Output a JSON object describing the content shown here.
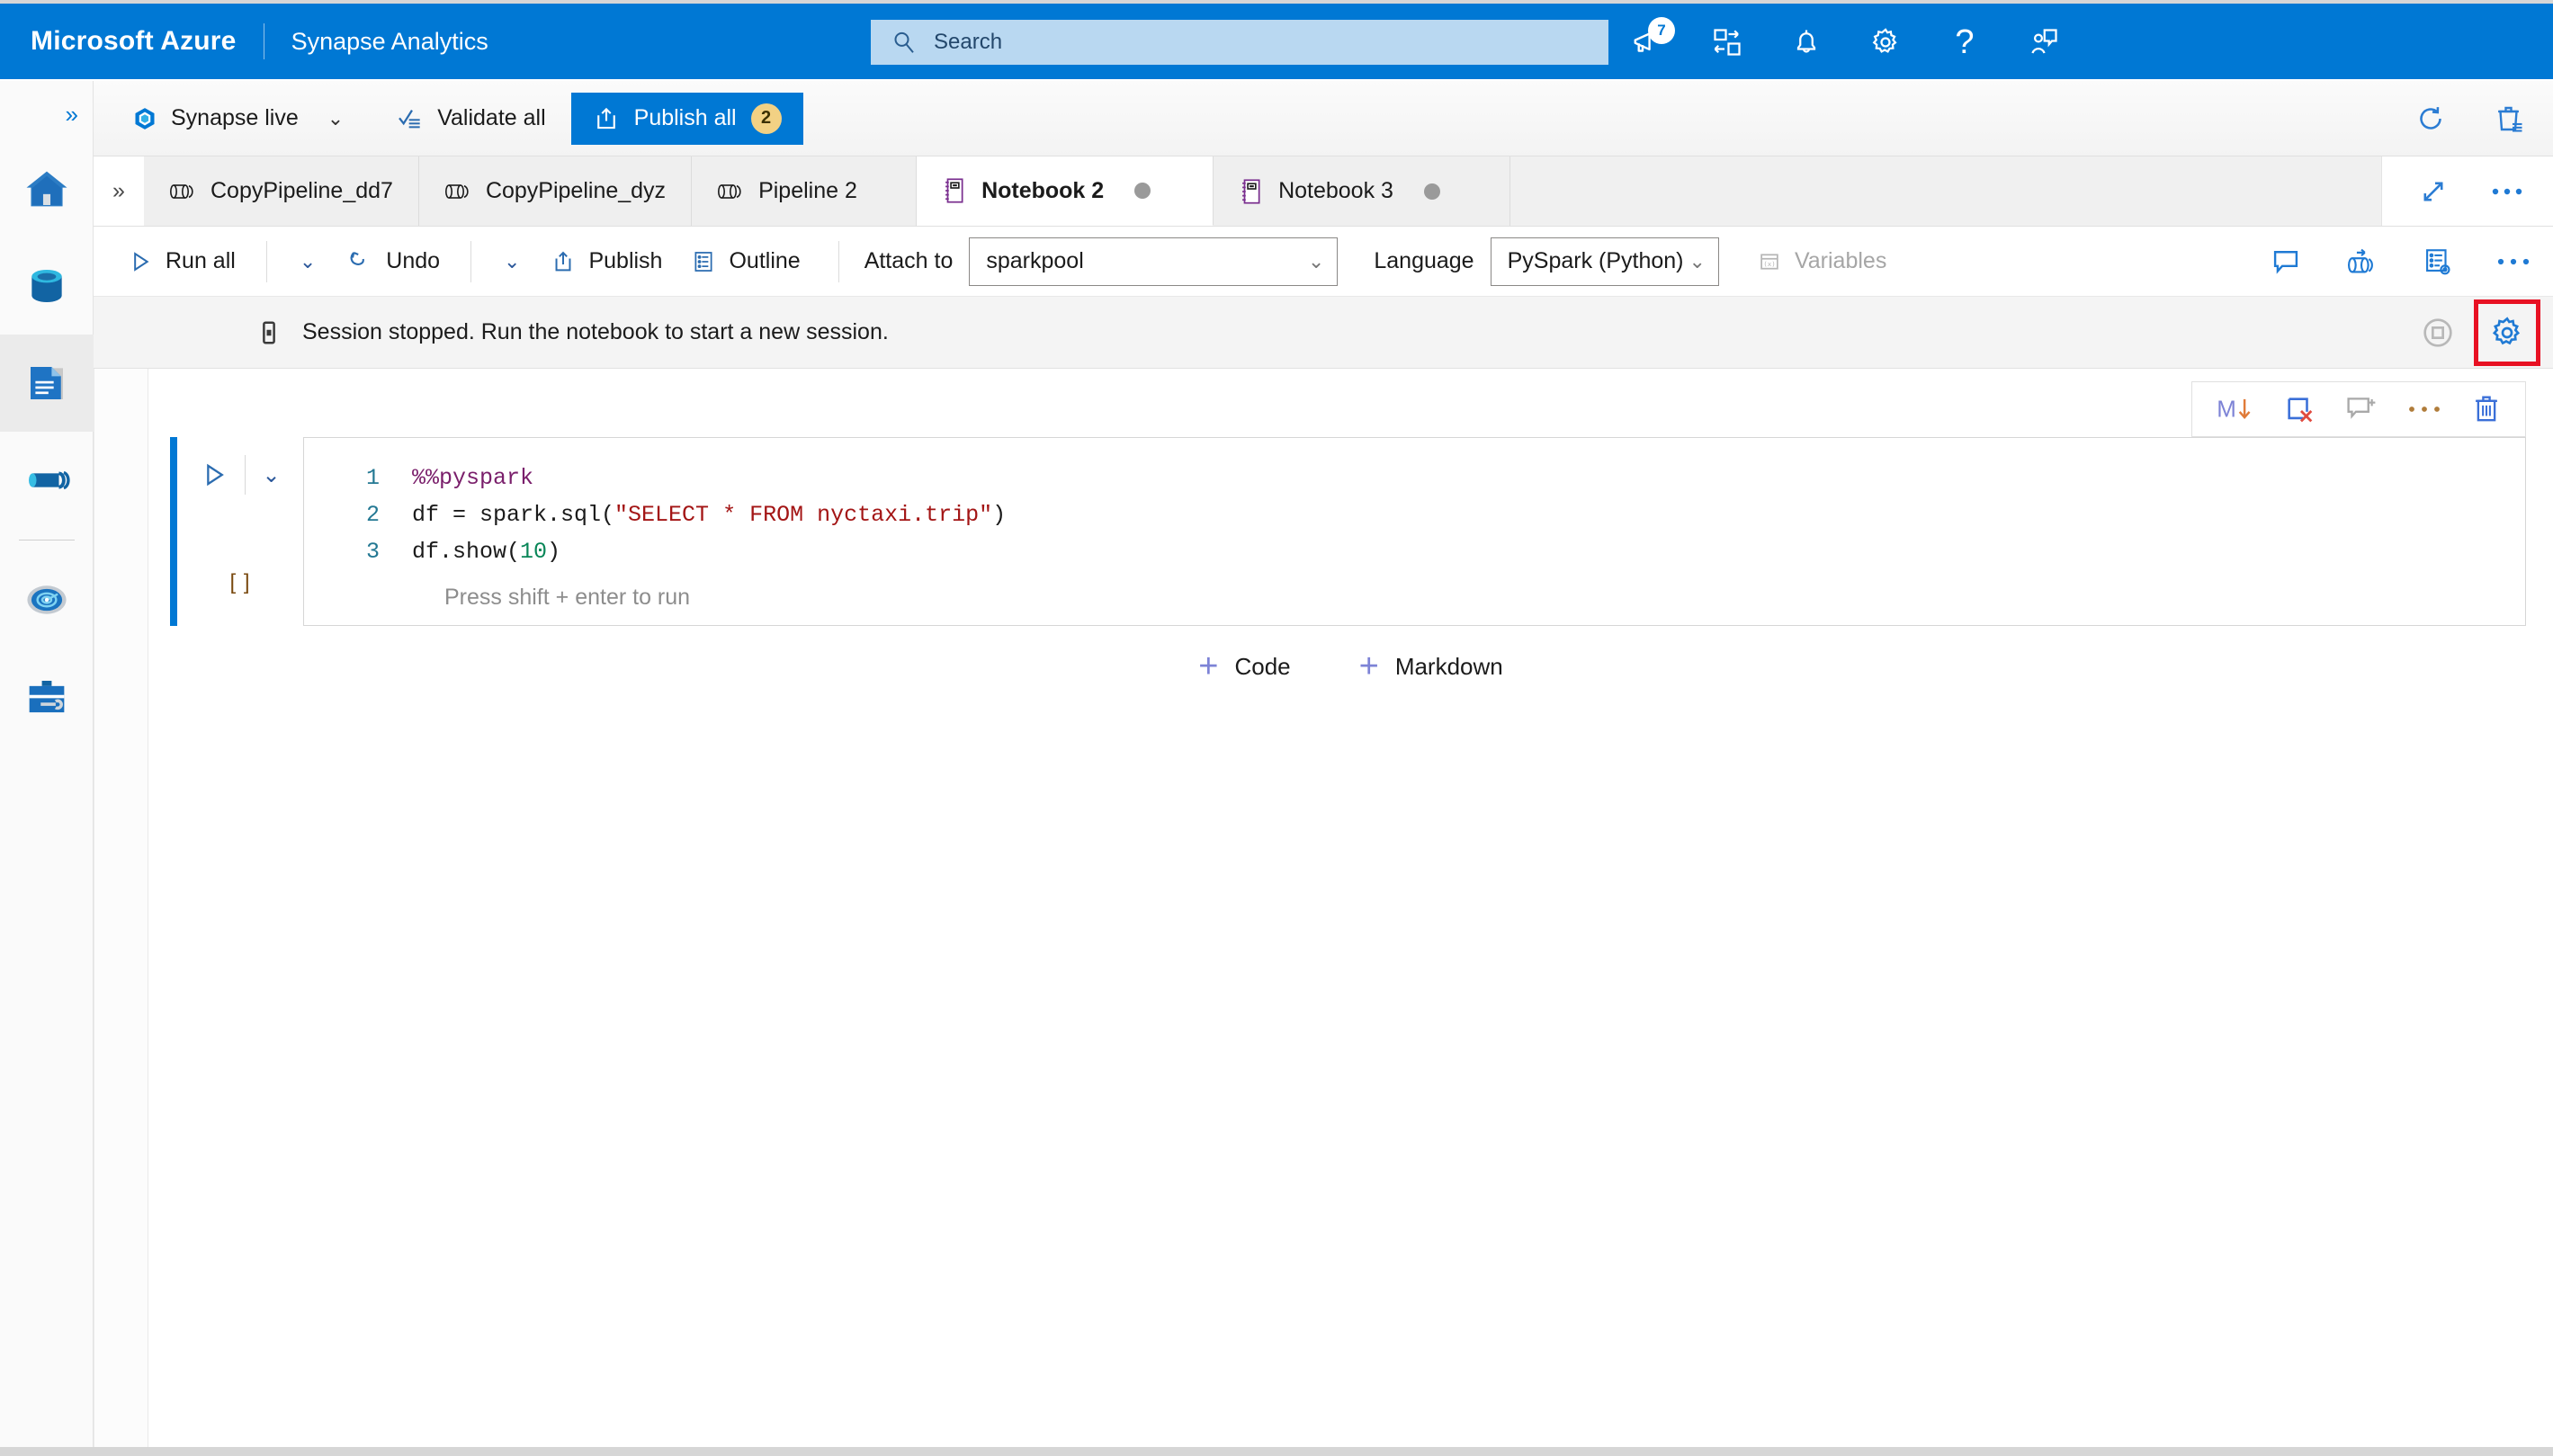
{
  "topbar": {
    "brand": "Microsoft Azure",
    "service": "Synapse Analytics",
    "search_placeholder": "Search",
    "icons": [
      {
        "name": "announcements-icon",
        "badge": "7"
      },
      {
        "name": "cloud-shell-icon",
        "badge": ""
      },
      {
        "name": "notifications-bell-icon",
        "badge": ""
      },
      {
        "name": "settings-gear-icon",
        "badge": ""
      },
      {
        "name": "help-question-icon",
        "badge": ""
      },
      {
        "name": "feedback-icon",
        "badge": ""
      }
    ],
    "accent_color": "#0078d4"
  },
  "rail": {
    "expand_label": "»",
    "items": [
      {
        "name": "home",
        "icon": "home-icon",
        "selected": false
      },
      {
        "name": "data",
        "icon": "data-cylinder-icon",
        "selected": false
      },
      {
        "name": "develop",
        "icon": "develop-document-icon",
        "selected": true
      },
      {
        "name": "integrate",
        "icon": "integrate-pipeline-icon",
        "selected": false
      },
      {
        "name": "monitor",
        "icon": "monitor-radar-icon",
        "selected": false
      },
      {
        "name": "manage",
        "icon": "manage-toolbox-icon",
        "selected": false
      }
    ]
  },
  "workspace_toolbar": {
    "mode_label": "Synapse live",
    "validate_label": "Validate all",
    "publish_all_label": "Publish all",
    "publish_all_count": "2",
    "publish_color": "#0078d4",
    "badge_color": "#f2d184",
    "refresh_icon": "refresh-icon",
    "discard_icon": "discard-all-trash-icon"
  },
  "tabs": {
    "overflow_label": "»",
    "items": [
      {
        "label": "CopyPipeline_dd7",
        "icon": "pipeline-icon",
        "active": false,
        "dirty": false
      },
      {
        "label": "CopyPipeline_dyz",
        "icon": "pipeline-icon",
        "active": false,
        "dirty": false
      },
      {
        "label": "Pipeline 2",
        "icon": "pipeline-icon",
        "active": false,
        "dirty": false
      },
      {
        "label": "Notebook 2",
        "icon": "notebook-icon",
        "active": true,
        "dirty": true
      },
      {
        "label": "Notebook 3",
        "icon": "notebook-icon",
        "active": false,
        "dirty": true
      }
    ],
    "expand_icon": "expand-diagonal-icon",
    "more_icon": "more-ellipsis-icon"
  },
  "notebook_toolbar": {
    "run_all_label": "Run all",
    "undo_label": "Undo",
    "publish_label": "Publish",
    "outline_label": "Outline",
    "attach_to_label": "Attach to",
    "attach_to_value": "sparkpool",
    "language_label": "Language",
    "language_value": "PySpark (Python)",
    "variables_label": "Variables",
    "variables_disabled": true,
    "right_icons": [
      {
        "name": "comments-icon"
      },
      {
        "name": "add-to-pipeline-icon"
      },
      {
        "name": "notebook-properties-icon"
      },
      {
        "name": "more-ellipsis-icon"
      }
    ]
  },
  "session": {
    "status_text": "Session stopped. Run the notebook to start a new session.",
    "status_icon": "session-stopped-icon",
    "stop_icon": "stop-session-icon",
    "config_icon": "session-configure-gear-icon",
    "highlight_color": "#e81123",
    "config_highlighted": true
  },
  "cell_toolbar": {
    "items": [
      {
        "name": "convert-to-markdown-icon",
        "label": "M↓"
      },
      {
        "name": "clear-output-icon",
        "label": ""
      },
      {
        "name": "add-comment-icon",
        "label": ""
      },
      {
        "name": "more-ellipsis-icon",
        "label": ""
      },
      {
        "name": "delete-cell-icon",
        "label": ""
      }
    ]
  },
  "cell": {
    "run_icon": "run-cell-icon",
    "collapse_icon": "chevron-down-icon",
    "execution_count": "[ ]",
    "lines": [
      {
        "number": "1",
        "tokens": [
          {
            "t": "%%pyspark",
            "c": "k-magic"
          }
        ]
      },
      {
        "number": "2",
        "tokens": [
          {
            "t": "df = spark.sql(",
            "c": "k-plain"
          },
          {
            "t": "\"SELECT * FROM nyctaxi.trip\"",
            "c": "k-str"
          },
          {
            "t": ")",
            "c": "k-plain"
          }
        ]
      },
      {
        "number": "3",
        "tokens": [
          {
            "t": "df.show(",
            "c": "k-plain"
          },
          {
            "t": "10",
            "c": "k-num"
          },
          {
            "t": ")",
            "c": "k-plain"
          }
        ]
      }
    ],
    "hint": "Press shift + enter to run",
    "accent_color": "#0078d4"
  },
  "add_cell": {
    "code_label": "Code",
    "markdown_label": "Markdown",
    "plus_glyph": "+"
  }
}
